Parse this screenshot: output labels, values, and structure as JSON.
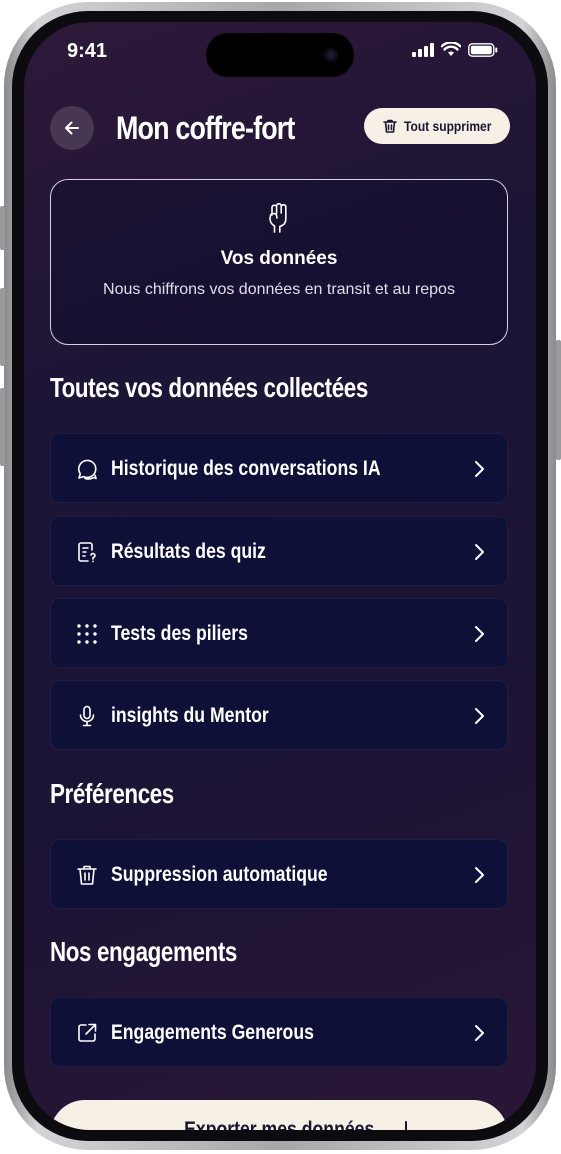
{
  "status_bar": {
    "time": "9:41"
  },
  "header": {
    "title": "Mon coffre-fort",
    "delete_all_label": "Tout supprimer"
  },
  "info_card": {
    "icon": "raised-fist-icon",
    "title": "Vos données",
    "text": "Nous chiffrons vos données en transit et au repos"
  },
  "sections": {
    "collected": {
      "title": "Toutes vos données collectées",
      "items": [
        {
          "label": "Historique des conversations IA",
          "icon": "chat-bubble-icon"
        },
        {
          "label": "Résultats des quiz",
          "icon": "quiz-document-icon"
        },
        {
          "label": "Tests des piliers",
          "icon": "dots-grid-icon"
        },
        {
          "label": "insights du Mentor",
          "icon": "microphone-icon"
        }
      ]
    },
    "preferences": {
      "title": "Préférences",
      "items": [
        {
          "label": "Suppression automatique",
          "icon": "trash-icon"
        }
      ]
    },
    "commitments": {
      "title": "Nos engagements",
      "items": [
        {
          "label": "Engagements Generous",
          "icon": "external-link-icon"
        }
      ]
    }
  },
  "export_button": {
    "label": "Exporter mes données"
  },
  "colors": {
    "background": "#1d1536",
    "row": "#0e1038",
    "cream": "#f7f0e6"
  }
}
